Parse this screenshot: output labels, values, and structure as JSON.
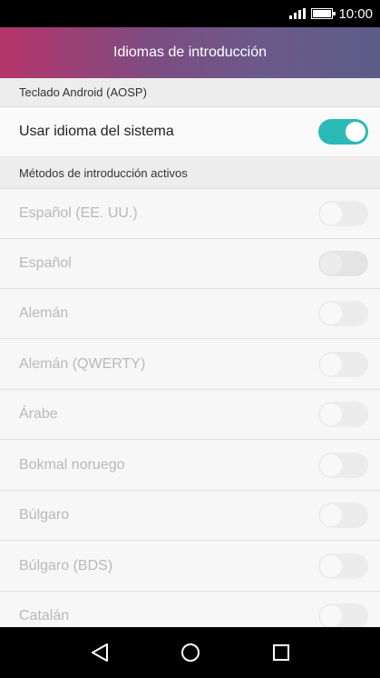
{
  "status_bar": {
    "time": "10:00"
  },
  "header": {
    "title": "Idiomas de introducción"
  },
  "sections": [
    {
      "title": "Teclado Android (AOSP)"
    },
    {
      "title": "Métodos de introducción activos"
    }
  ],
  "system_language": {
    "label": "Usar idioma del sistema",
    "enabled": true
  },
  "languages": [
    {
      "label": "Español (EE. UU.)",
      "checked": false
    },
    {
      "label": "Español",
      "checked": false
    },
    {
      "label": "Alemán",
      "checked": false
    },
    {
      "label": "Alemán (QWERTY)",
      "checked": false
    },
    {
      "label": "Árabe",
      "checked": false
    },
    {
      "label": "Bokmal noruego",
      "checked": false
    },
    {
      "label": "Búlgaro",
      "checked": false
    },
    {
      "label": "Búlgaro (BDS)",
      "checked": false
    },
    {
      "label": "Catalán",
      "checked": false
    }
  ],
  "colors": {
    "accent": "#2bb9b5",
    "header_start": "#b5356a",
    "header_end": "#5b5c87"
  },
  "nav": {
    "back": "back-icon",
    "home": "home-icon",
    "recents": "recents-icon"
  }
}
